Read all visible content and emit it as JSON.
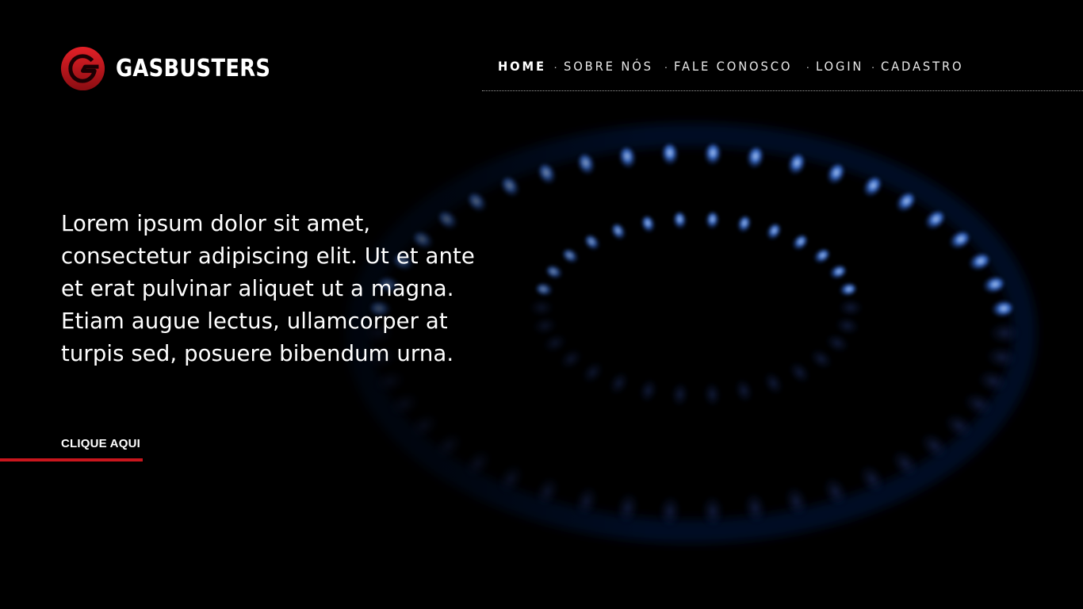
{
  "brand": {
    "name": "GASBUSTERS",
    "logo_icon": "g-logo-icon",
    "accent_color": "#c8161d"
  },
  "nav": {
    "items": [
      {
        "label": "HOME",
        "active": true
      },
      {
        "label": "SOBRE NÓS",
        "active": false
      },
      {
        "label": "FALE CONOSCO",
        "active": false
      },
      {
        "label": "LOGIN",
        "active": false
      },
      {
        "label": "CADASTRO",
        "active": false
      }
    ],
    "separator": "·"
  },
  "hero": {
    "text": "Lorem ipsum dolor sit amet, consectetur adipiscing elit. Ut et ante et erat pulvinar aliquet ut a magna. Etiam augue lectus, ullamcorper at turpis sed, posuere bibendum urna.",
    "cta_label": "CLIQUE AQUI",
    "background": "gas-burner-flame-image",
    "flame_color": "#2f6fe6"
  }
}
